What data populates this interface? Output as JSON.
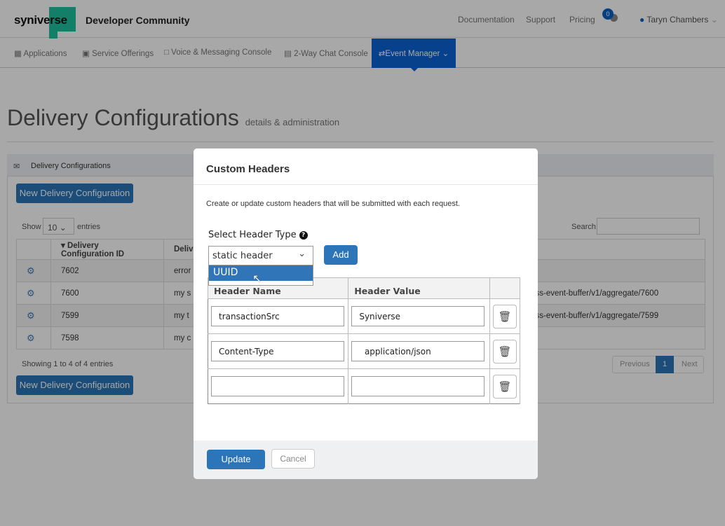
{
  "header": {
    "logo": "syniverse",
    "brand": "Developer Community",
    "links": [
      "Documentation",
      "Support",
      "Pricing"
    ],
    "notification_count": "0",
    "user": "Taryn Chambers",
    "accent": "#1fc1a0"
  },
  "nav": {
    "items": [
      "Applications",
      "Service Offerings",
      "Voice & Messaging Console",
      "2-Way Chat Console"
    ],
    "active": "Event Manager"
  },
  "page": {
    "title": "Delivery Configurations",
    "subtitle": "details & administration"
  },
  "panel": {
    "title": "Delivery Configurations",
    "new_button": "New Delivery Configuration",
    "show": "Show",
    "entries_value": "10",
    "entries": "entries",
    "search_label": "Search:",
    "columns": [
      "Delivery Configuration ID",
      "Delive"
    ],
    "rows": [
      {
        "id": "7602",
        "desc": "error",
        "url": ""
      },
      {
        "id": "7600",
        "desc": "my s",
        "url": "ss-event-buffer/v1/aggregate/7600"
      },
      {
        "id": "7599",
        "desc": "my t",
        "url": "ss-event-buffer/v1/aggregate/7599"
      },
      {
        "id": "7598",
        "desc": "my c",
        "url": ""
      }
    ],
    "info": "Showing 1 to 4 of 4 entries",
    "prev": "Previous",
    "page": "1",
    "next": "Next"
  },
  "modal": {
    "title": "Custom Headers",
    "description": "Create or update custom headers that will be submitted with each request.",
    "select_label": "Select Header Type",
    "select_value": "static header",
    "dropdown_option": "UUID",
    "add": "Add",
    "col_name": "Header Name",
    "col_value": "Header Value",
    "headers": [
      {
        "name": "transactionSrc",
        "value": "Syniverse"
      },
      {
        "name": "Content-Type",
        "value": "  application/json"
      },
      {
        "name": "",
        "value": ""
      }
    ],
    "update": "Update",
    "cancel": "Cancel"
  }
}
